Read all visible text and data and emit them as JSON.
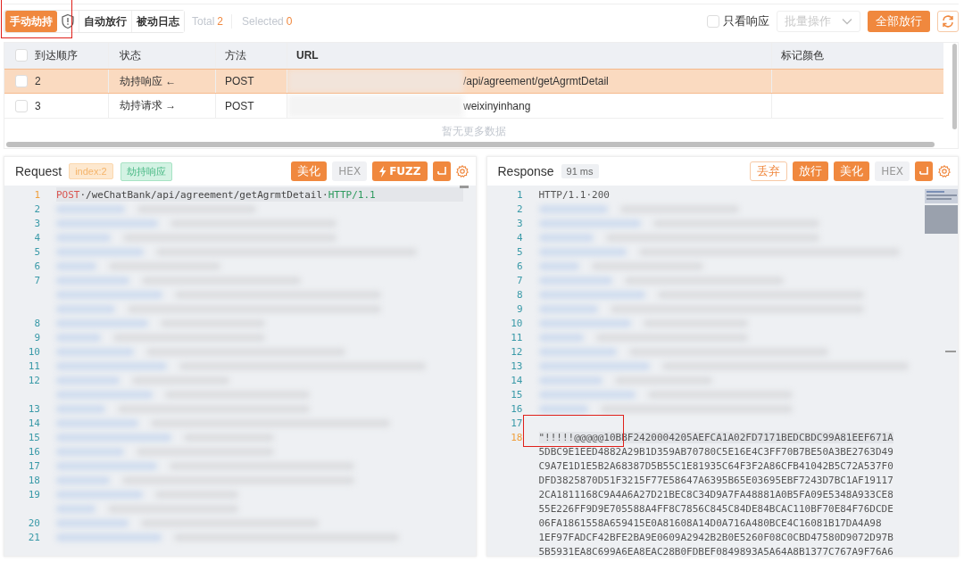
{
  "toolbar": {
    "modes": [
      {
        "label": "手动劫持",
        "selected": true,
        "highlighted": true
      },
      {
        "label": "自动放行",
        "selected": false
      },
      {
        "label": "被动日志",
        "selected": false
      }
    ],
    "total_label": "Total",
    "total": "2",
    "selected_label": "Selected",
    "selected_count": "0",
    "only_response": {
      "label": "只看响应",
      "checked": false
    },
    "batch": {
      "placeholder": "批量操作",
      "disabled": true
    },
    "release_all": "全部放行"
  },
  "table": {
    "header_checked": false,
    "columns": [
      "到达顺序",
      "状态",
      "方法",
      "URL",
      "标记颜色"
    ],
    "rows": [
      {
        "order": "2",
        "status": "劫持响应 ←",
        "method": "POST",
        "url": "/api/agreement/getAgrmtDetail",
        "checked": false,
        "selected": true
      },
      {
        "order": "3",
        "status": "劫持请求 →",
        "method": "POST",
        "url": "weixinyinhang",
        "checked": false,
        "selected": false
      }
    ],
    "empty_text": "暂无更多数据"
  },
  "request": {
    "title": "Request",
    "tags": [
      {
        "text": "index:2",
        "kind": "orange"
      },
      {
        "text": "劫持响应",
        "kind": "green"
      }
    ],
    "buttons": [
      {
        "label": "美化",
        "kind": "primary"
      },
      {
        "label": "HEX",
        "kind": "grey"
      },
      {
        "label": "FUZZ",
        "kind": "fuzz"
      },
      {
        "kind": "wrap"
      }
    ],
    "lines": [
      {
        "kind": "code",
        "number": "1",
        "active": true,
        "segments": [
          {
            "text": "POST",
            "color": "#d9534f"
          },
          {
            "text": "·/weChatBank/api/agreement/getAgrmtDetail·",
            "color": "#444444"
          },
          {
            "text": "HTTP/1.1",
            "color": "#2e9a5e"
          }
        ]
      },
      {
        "kind": "redacted",
        "number": "2"
      },
      {
        "kind": "redacted",
        "number": "3"
      },
      {
        "kind": "redacted",
        "number": "4"
      },
      {
        "kind": "redacted",
        "number": "5"
      },
      {
        "kind": "redacted",
        "number": "6"
      },
      {
        "kind": "redacted",
        "number": "7"
      },
      {
        "kind": "redacted-wrap"
      },
      {
        "kind": "redacted-wrap"
      },
      {
        "kind": "redacted",
        "number": "8"
      },
      {
        "kind": "redacted",
        "number": "9"
      },
      {
        "kind": "redacted",
        "number": "10"
      },
      {
        "kind": "redacted",
        "number": "11"
      },
      {
        "kind": "redacted",
        "number": "12"
      },
      {
        "kind": "redacted-wrap"
      },
      {
        "kind": "redacted",
        "number": "13"
      },
      {
        "kind": "redacted",
        "number": "14"
      },
      {
        "kind": "redacted",
        "number": "15"
      },
      {
        "kind": "redacted",
        "number": "16"
      },
      {
        "kind": "redacted",
        "number": "17"
      },
      {
        "kind": "redacted",
        "number": "18"
      },
      {
        "kind": "redacted",
        "number": "19"
      },
      {
        "kind": "redacted-wrap"
      },
      {
        "kind": "redacted",
        "number": "20"
      },
      {
        "kind": "redacted",
        "number": "21"
      }
    ]
  },
  "response": {
    "title": "Response",
    "tags": [
      {
        "text": "91 ms",
        "kind": "grey"
      }
    ],
    "buttons": [
      {
        "label": "丢弃",
        "kind": "outline"
      },
      {
        "label": "放行",
        "kind": "primary"
      },
      {
        "label": "美化",
        "kind": "primary"
      },
      {
        "label": "HEX",
        "kind": "grey"
      },
      {
        "kind": "wrap"
      }
    ],
    "lines": [
      {
        "kind": "code",
        "number": "1",
        "active": false,
        "segments": [
          {
            "text": "HTTP/1.1·200",
            "color": "#555555"
          }
        ]
      },
      {
        "kind": "redacted",
        "number": "2"
      },
      {
        "kind": "redacted",
        "number": "3"
      },
      {
        "kind": "redacted",
        "number": "4"
      },
      {
        "kind": "redacted",
        "number": "5"
      },
      {
        "kind": "redacted",
        "number": "6"
      },
      {
        "kind": "redacted",
        "number": "7"
      },
      {
        "kind": "redacted",
        "number": "8"
      },
      {
        "kind": "redacted",
        "number": "9"
      },
      {
        "kind": "redacted",
        "number": "10"
      },
      {
        "kind": "redacted",
        "number": "11"
      },
      {
        "kind": "redacted",
        "number": "12"
      },
      {
        "kind": "redacted",
        "number": "13"
      },
      {
        "kind": "redacted",
        "number": "14"
      },
      {
        "kind": "redacted",
        "number": "15"
      },
      {
        "kind": "redacted",
        "number": "16"
      },
      {
        "kind": "blank",
        "number": "17"
      },
      {
        "kind": "code",
        "number": "18",
        "active": true,
        "highlighted": true,
        "segments": [
          {
            "text": "\"!!!!!@@@@@10BBF2420004205AEFCA1A02FD7171BEDCBDC99A81EEF671A",
            "color": "#555555"
          }
        ]
      },
      {
        "kind": "wrap",
        "text": "5DBC9E1EED4882A29B1D359AB70780C5E16E4C3FF70B7BE50A3BE2763D49"
      },
      {
        "kind": "wrap",
        "text": "C9A7E1D1E5B2A68387D5B55C1E81935C64F3F2A86CFB41042B5C72A537F0"
      },
      {
        "kind": "wrap",
        "text": "DFD3825870D51F3215F77E58647A6395B65E03695EBF7243D7BC1AF19117"
      },
      {
        "kind": "wrap",
        "text": "2CA1811168C9A4A6A27D21BEC8C34D9A7FA48881A0B5FA09E5348A933CE8"
      },
      {
        "kind": "wrap",
        "text": "55E226FF9D9E705588A4FF8C7856C845C84DE84BCAC110BF70E84F76DCDE"
      },
      {
        "kind": "wrap",
        "text": "06FA1861558A659415E0A81608A14D0A716A480BCE4C16081B17DA4A98"
      },
      {
        "kind": "wrap",
        "text": "1EF97FADCF42BFE2BA9E0609A2942B2B0E5260F08C0CBD47580D9072D97B"
      },
      {
        "kind": "wrap",
        "text": "5B5931EA8C699A6EA8EAC28B0FDBEF0849893A5A64A8B1377C767A9F76A6"
      }
    ]
  }
}
